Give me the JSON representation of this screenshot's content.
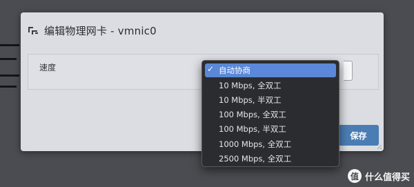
{
  "dialog": {
    "title": "编辑物理网卡 - vmnic0",
    "speed_label": "速度",
    "save_label": "保存"
  },
  "speed_menu": {
    "selected": "自动协商",
    "check_mark": "✓",
    "options": [
      "自动协商",
      "10 Mbps, 全双工",
      "10 Mbps, 半双工",
      "100 Mbps, 全双工",
      "100 Mbps, 半双工",
      "1000 Mbps, 全双工",
      "2500 Mbps, 全双工"
    ]
  },
  "watermark": {
    "logo_text": "值",
    "text": "什么值得买"
  },
  "colors": {
    "accent": "#5b88d8",
    "save_button": "#4b7db5",
    "menu_bg": "#2b2c2f",
    "dialog_bg": "#dcdde2",
    "backdrop": "#4b4c51"
  }
}
